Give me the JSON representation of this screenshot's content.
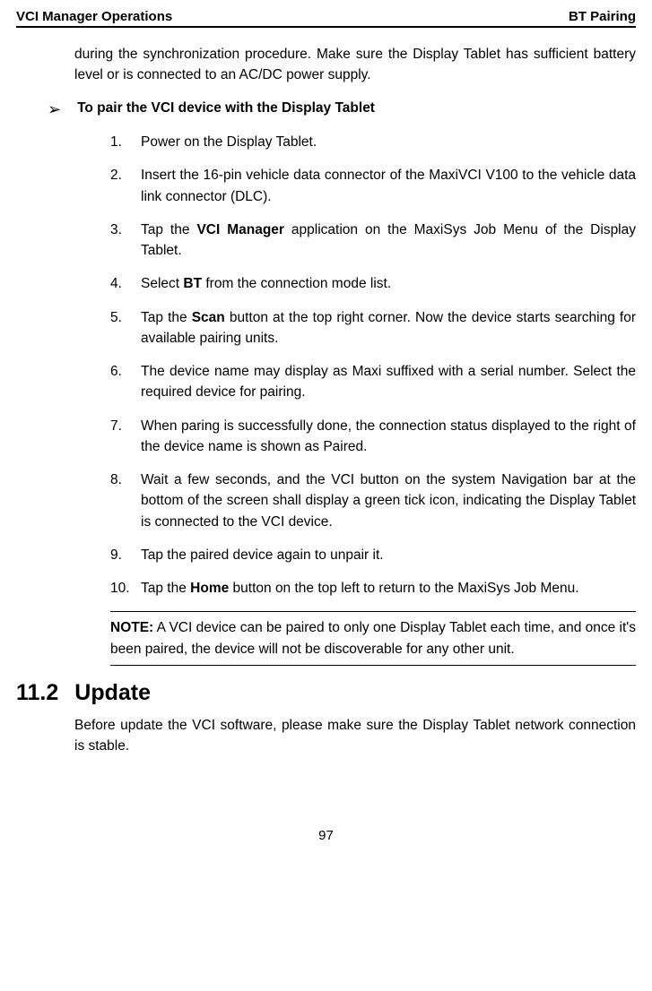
{
  "header": {
    "left": "VCI Manager Operations",
    "right": "BT Pairing"
  },
  "intro": "during the synchronization procedure. Make sure the Display Tablet has sufficient battery level or is connected to an AC/DC power supply.",
  "arrow_title": "To pair the VCI device with the Display Tablet",
  "steps": {
    "n1": "1.",
    "s1": "Power on the Display Tablet.",
    "n2": "2.",
    "s2": "Insert the 16-pin vehicle data connector of the MaxiVCI V100 to the vehicle data link connector (DLC).",
    "n3": "3.",
    "s3a": "Tap the ",
    "s3b": "VCI Manager",
    "s3c": " application on the MaxiSys Job Menu of the Display Tablet.",
    "n4": "4.",
    "s4a": "Select ",
    "s4b": "BT",
    "s4c": " from the connection mode list.",
    "n5": "5.",
    "s5a": "Tap the ",
    "s5b": "Scan",
    "s5c": " button at the top right corner. Now the device starts searching for available pairing units.",
    "n6": "6.",
    "s6": "The device name may display as Maxi suffixed with a serial number. Select the required device for pairing.",
    "n7": "7.",
    "s7": "When paring is successfully done, the connection status displayed to the right of the device name is shown as Paired.",
    "n8": "8.",
    "s8": "Wait a few seconds, and the VCI button on the system Navigation bar at the bottom of the screen shall display a green tick icon, indicating the Display Tablet is connected to the VCI device.",
    "n9": "9.",
    "s9": "Tap the paired device again to unpair it.",
    "n10": "10.",
    "s10a": "Tap the ",
    "s10b": "Home",
    "s10c": " button on the top left to return to the MaxiSys Job Menu."
  },
  "note": {
    "label": "NOTE:",
    "text": " A VCI device can be paired to only one Display Tablet each time, and once it's been paired, the device will not be discoverable for any other unit."
  },
  "section": {
    "num": "11.2",
    "title": "Update",
    "body": "Before update the VCI software, please make sure the Display Tablet network connection is stable."
  },
  "page_num": "97"
}
